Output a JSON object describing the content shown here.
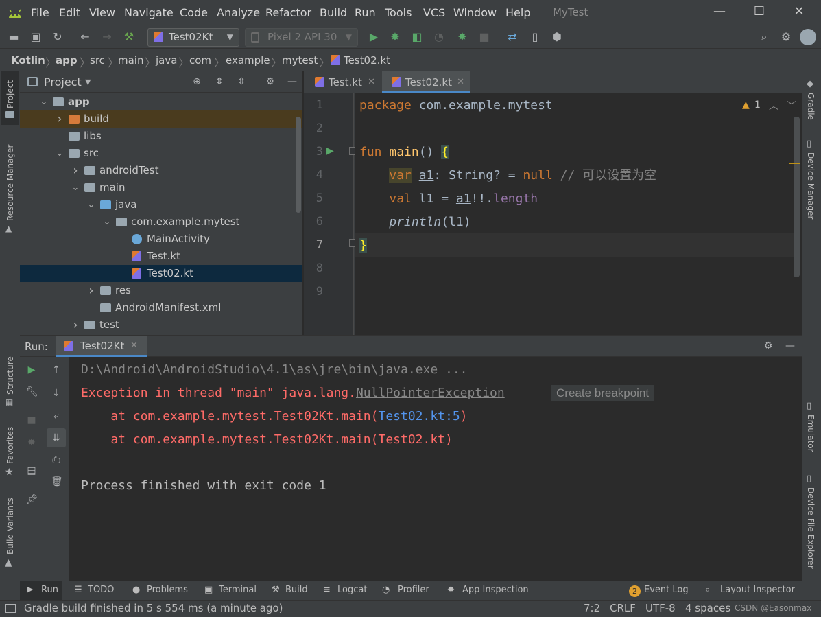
{
  "menu": {
    "items": [
      "File",
      "Edit",
      "View",
      "Navigate",
      "Code",
      "Analyze",
      "Refactor",
      "Build",
      "Run",
      "Tools",
      "VCS",
      "Window",
      "Help"
    ],
    "title": "MyTest"
  },
  "toolbar": {
    "run_config": "Test02Kt",
    "device": "Pixel 2 API 30"
  },
  "breadcrumb": [
    "Kotlin",
    "app",
    "src",
    "main",
    "java",
    "com",
    "example",
    "mytest",
    "Test02.kt"
  ],
  "left_tabs": {
    "project": "Project",
    "resource_manager": "Resource Manager",
    "structure": "Structure",
    "favorites": "Favorites",
    "build_variants": "Build Variants"
  },
  "right_tabs": {
    "gradle": "Gradle",
    "device_manager": "Device Manager",
    "emulator": "Emulator",
    "device_file_explorer": "Device File Explorer"
  },
  "project_panel": {
    "title": "Project",
    "tree": [
      {
        "label": "app",
        "level": 0,
        "arrow": "down",
        "icon": "folder-module",
        "bold": true
      },
      {
        "label": "build",
        "level": 1,
        "arrow": "right",
        "icon": "folder-orange"
      },
      {
        "label": "libs",
        "level": 1,
        "arrow": "none",
        "icon": "folder"
      },
      {
        "label": "src",
        "level": 1,
        "arrow": "down",
        "icon": "folder"
      },
      {
        "label": "androidTest",
        "level": 2,
        "arrow": "right",
        "icon": "folder"
      },
      {
        "label": "main",
        "level": 2,
        "arrow": "down",
        "icon": "folder"
      },
      {
        "label": "java",
        "level": 3,
        "arrow": "down",
        "icon": "folder-blue"
      },
      {
        "label": "com.example.mytest",
        "level": 4,
        "arrow": "down",
        "icon": "package"
      },
      {
        "label": "MainActivity",
        "level": 5,
        "arrow": "none",
        "icon": "class"
      },
      {
        "label": "Test.kt",
        "level": 5,
        "arrow": "none",
        "icon": "kotlin-file"
      },
      {
        "label": "Test02.kt",
        "level": 5,
        "arrow": "none",
        "icon": "kotlin-file",
        "selected": true
      },
      {
        "label": "res",
        "level": 3,
        "arrow": "right",
        "icon": "folder-res"
      },
      {
        "label": "AndroidManifest.xml",
        "level": 3,
        "arrow": "none",
        "icon": "manifest"
      },
      {
        "label": "test",
        "level": 2,
        "arrow": "right",
        "icon": "folder"
      }
    ]
  },
  "editor": {
    "tabs": [
      {
        "label": "Test.kt",
        "active": false
      },
      {
        "label": "Test02.kt",
        "active": true
      }
    ],
    "line_numbers": [
      "1",
      "2",
      "3",
      "4",
      "5",
      "6",
      "7",
      "8",
      "9"
    ],
    "warnings": "1",
    "code": {
      "l1_kw": "package",
      "l1_rest": " com.example.mytest",
      "l3_kw": "fun",
      "l3_fn": "main",
      "l3_parens": "() ",
      "l3_brace": "{",
      "l4_kw": "var",
      "l4_sp": " ",
      "l4_var": "a1",
      "l4_mid": ": String? = ",
      "l4_null": "null",
      "l4_comment": " // 可以设置为空",
      "l5_kw": "val",
      "l5_mid": " l1 = ",
      "l5_var": "a1",
      "l5_ops": "!!.",
      "l5_prop": "length",
      "l6_fn": "println",
      "l6_rest": "(l1)",
      "l7_brace": "}"
    }
  },
  "run_panel": {
    "label": "Run:",
    "tab": "Test02Kt",
    "lines": {
      "cmd": "D:\\Android\\AndroidStudio\\4.1\\as\\jre\\bin\\java.exe ...",
      "ex_prefix": "Exception in thread \"main\" java.lang.",
      "ex_class": "NullPointerException",
      "ex_hint": "Create breakpoint",
      "at1_prefix": "    at com.example.mytest.Test02Kt.main(",
      "at1_link": "Test02.kt:5",
      "at1_suffix": ")",
      "at2": "    at com.example.mytest.Test02Kt.main(Test02.kt)",
      "finished": "Process finished with exit code 1"
    }
  },
  "bottom_tabs": [
    "Run",
    "TODO",
    "Problems",
    "Terminal",
    "Build",
    "Logcat",
    "Profiler",
    "App Inspection"
  ],
  "bottom_right_tabs": {
    "event_log": "Event Log",
    "event_count": "2",
    "layout_inspector": "Layout Inspector"
  },
  "status": {
    "message": "Gradle build finished in 5 s 554 ms (a minute ago)",
    "position": "7:2",
    "line_sep": "CRLF",
    "encoding": "UTF-8",
    "indent": "4 spaces",
    "watermark": "CSDN @Easonmax"
  },
  "colors": {
    "keyword": "#cc7832",
    "function": "#ffc66d",
    "comment": "#808080",
    "property": "#9876aa",
    "error": "#ff6b68",
    "link": "#5394ec",
    "run_green": "#59a869"
  }
}
